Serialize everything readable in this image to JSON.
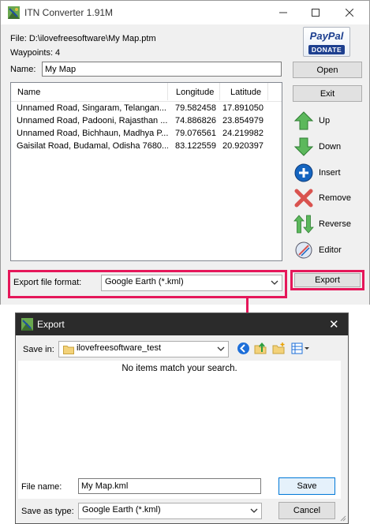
{
  "main_window": {
    "title": "ITN Converter 1.91M",
    "file_label": "File: D:\\ilovefreesoftware\\My Map.ptm",
    "waypoints_label": "Waypoints: 4",
    "name_label": "Name:",
    "name_value": "My Map",
    "paypal": {
      "brand": "PayPal",
      "action": "DONATE"
    },
    "buttons": {
      "open": "Open",
      "exit": "Exit",
      "export": "Export"
    },
    "actions": [
      {
        "label": "Up",
        "icon": "arrow-up-icon"
      },
      {
        "label": "Down",
        "icon": "arrow-down-icon"
      },
      {
        "label": "Insert",
        "icon": "insert-icon"
      },
      {
        "label": "Remove",
        "icon": "remove-icon"
      },
      {
        "label": "Reverse",
        "icon": "reverse-icon"
      },
      {
        "label": "Editor",
        "icon": "editor-icon"
      }
    ],
    "table": {
      "columns": [
        "Name",
        "Longitude",
        "Latitude"
      ],
      "rows": [
        [
          "Unnamed Road, Singaram, Telangan...",
          "79.582458",
          "17.891050"
        ],
        [
          "Unnamed Road, Padooni, Rajasthan ...",
          "74.886826",
          "23.854979"
        ],
        [
          "Unnamed Road, Bichhaun, Madhya P...",
          "79.076561",
          "24.219982"
        ],
        [
          "Gaisilat Road, Budamal, Odisha 7680...",
          "83.122559",
          "20.920397"
        ]
      ]
    },
    "export_format_label": "Export file format:",
    "export_format_value": "Google Earth (*.kml)"
  },
  "export_dialog": {
    "title": "Export",
    "save_in_label": "Save in:",
    "save_in_value": "ilovefreesoftware_test",
    "empty_message": "No items match your search.",
    "file_name_label": "File name:",
    "file_name_value": "My Map.kml",
    "save_as_type_label": "Save as type:",
    "save_as_type_value": "Google Earth (*.kml)",
    "buttons": {
      "save": "Save",
      "cancel": "Cancel"
    }
  },
  "colors": {
    "highlight": "#e5175a",
    "dialog_titlebar": "#2b2b2b",
    "paypal_blue": "#1d3f8f"
  }
}
